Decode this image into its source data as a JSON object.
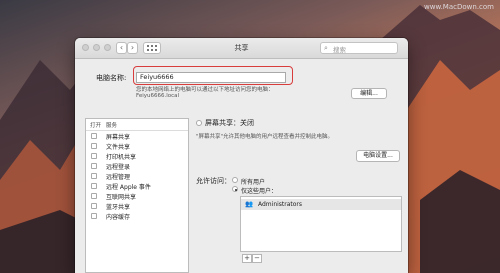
{
  "watermark": "www.MacDown.com",
  "window": {
    "title": "共享",
    "search_placeholder": "搜索",
    "nav_back": "‹",
    "nav_forward": "›"
  },
  "computer_name": {
    "label": "电脑名称:",
    "value": "Feiyu6666",
    "info_line": "您的本地网络上的电脑可以通过以下地址访问您的电脑：",
    "address": "Feiyu6666.local",
    "edit_button": "编辑..."
  },
  "services": {
    "header_on": "打开",
    "header_service": "服务",
    "items": [
      {
        "label": "屏幕共享",
        "checked": false
      },
      {
        "label": "文件共享",
        "checked": false
      },
      {
        "label": "打印机共享",
        "checked": false
      },
      {
        "label": "远程登录",
        "checked": false
      },
      {
        "label": "远程管理",
        "checked": false
      },
      {
        "label": "远程 Apple 事件",
        "checked": false
      },
      {
        "label": "互联网共享",
        "checked": false
      },
      {
        "label": "蓝牙共享",
        "checked": false
      },
      {
        "label": "内容缓存",
        "checked": false
      }
    ]
  },
  "screen_sharing": {
    "status": "屏幕共享：关闭",
    "description": "\"屏幕共享\"允许其他电脑的用户远程查看并控制此电脑。",
    "settings_button": "电脑设置..."
  },
  "access": {
    "label": "允许访问：",
    "option_all": "所有用户",
    "option_only": "仅这些用户：",
    "selected": "option_only",
    "users": [
      "Administrators"
    ],
    "add": "+",
    "remove": "−"
  }
}
